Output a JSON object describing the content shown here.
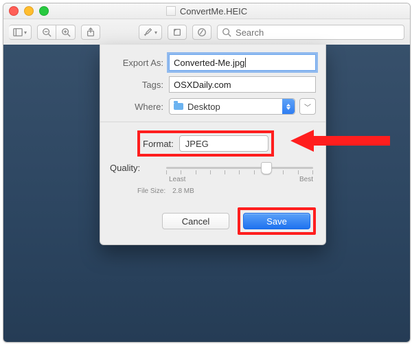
{
  "window": {
    "title": "ConvertMe.HEIC"
  },
  "toolbar": {
    "search_placeholder": "Search"
  },
  "sheet": {
    "export_as_label": "Export As:",
    "export_as_value": "Converted-Me.jpg",
    "tags_label": "Tags:",
    "tags_value": "OSXDaily.com",
    "where_label": "Where:",
    "where_value": "Desktop",
    "format_label": "Format:",
    "format_value": "JPEG",
    "quality_label": "Quality:",
    "quality_least": "Least",
    "quality_best": "Best",
    "filesize_label": "File Size:",
    "filesize_value": "2.8 MB",
    "cancel": "Cancel",
    "save": "Save"
  },
  "annotation": {
    "arrow_color": "#ff1e1e",
    "highlight_color": "#ff1e1e"
  }
}
